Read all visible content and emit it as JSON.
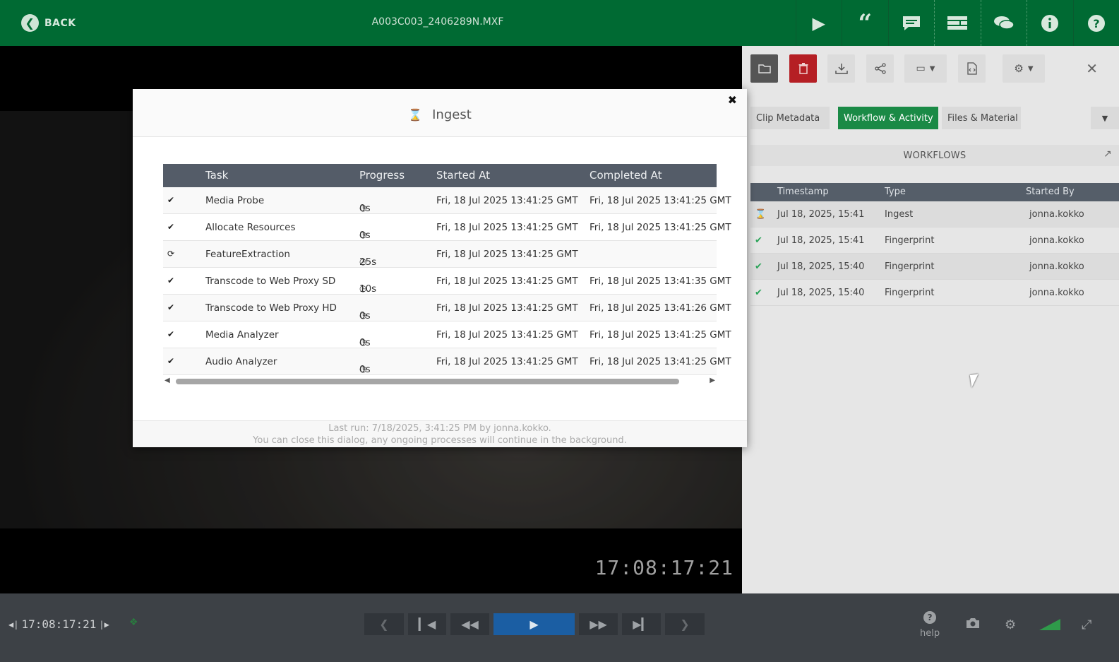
{
  "header": {
    "back_label": "BACK",
    "file_title": "A003C003_2406289N.MXF",
    "icons": [
      "play-icon",
      "quote-icon",
      "comment-icon",
      "layers-icon",
      "chat-icon",
      "info-icon",
      "help-icon"
    ]
  },
  "video": {
    "timecode": "17:08:17:21"
  },
  "panel": {
    "toolbar_icons": [
      "folder-icon",
      "trash-icon",
      "download-icon",
      "share-icon",
      "tag-icon",
      "document-icon",
      "settings-icon",
      "close-icon"
    ],
    "tabs": [
      {
        "label": "Clip Metadata"
      },
      {
        "label": "Workflow & Activity"
      },
      {
        "label": "Files & Material"
      }
    ],
    "workflows_label": "WORKFLOWS",
    "columns": {
      "timestamp": "Timestamp",
      "type": "Type",
      "started_by": "Started By"
    },
    "rows": [
      {
        "status": "running",
        "timestamp": "Jul 18, 2025, 15:41",
        "type": "Ingest",
        "started_by": "jonna.kokko"
      },
      {
        "status": "done",
        "timestamp": "Jul 18, 2025, 15:41",
        "type": "Fingerprint",
        "started_by": "jonna.kokko"
      },
      {
        "status": "done",
        "timestamp": "Jul 18, 2025, 15:40",
        "type": "Fingerprint",
        "started_by": "jonna.kokko"
      },
      {
        "status": "done",
        "timestamp": "Jul 18, 2025, 15:40",
        "type": "Fingerprint",
        "started_by": "jonna.kokko"
      }
    ]
  },
  "modal": {
    "title": "Ingest",
    "columns": {
      "task": "Task",
      "progress": "Progress",
      "started_at": "Started At",
      "completed_at": "Completed At"
    },
    "tasks": [
      {
        "status": "done",
        "task": "Media Probe",
        "progress": "0s",
        "started_at": "Fri, 18 Jul 2025 13:41:25 GMT",
        "completed_at": "Fri, 18 Jul 2025 13:41:25 GMT"
      },
      {
        "status": "done",
        "task": "Allocate Resources",
        "progress": "0s",
        "started_at": "Fri, 18 Jul 2025 13:41:25 GMT",
        "completed_at": "Fri, 18 Jul 2025 13:41:25 GMT"
      },
      {
        "status": "running",
        "task": "FeatureExtraction",
        "progress": "25s",
        "started_at": "Fri, 18 Jul 2025 13:41:25 GMT",
        "completed_at": ""
      },
      {
        "status": "done",
        "task": "Transcode to Web Proxy SD",
        "progress": "10s",
        "started_at": "Fri, 18 Jul 2025 13:41:25 GMT",
        "completed_at": "Fri, 18 Jul 2025 13:41:35 GMT"
      },
      {
        "status": "done",
        "task": "Transcode to Web Proxy HD",
        "progress": "0s",
        "started_at": "Fri, 18 Jul 2025 13:41:25 GMT",
        "completed_at": "Fri, 18 Jul 2025 13:41:26 GMT"
      },
      {
        "status": "done",
        "task": "Media Analyzer",
        "progress": "0s",
        "started_at": "Fri, 18 Jul 2025 13:41:25 GMT",
        "completed_at": "Fri, 18 Jul 2025 13:41:25 GMT"
      },
      {
        "status": "done",
        "task": "Audio Analyzer",
        "progress": "0s",
        "started_at": "Fri, 18 Jul 2025 13:41:25 GMT",
        "completed_at": "Fri, 18 Jul 2025 13:41:25 GMT"
      }
    ],
    "footer_line1": "Last run: 7/18/2025, 3:41:25 PM by jonna.kokko.",
    "footer_line2": "You can close this dialog, any ongoing processes will continue in the background."
  },
  "controls": {
    "timecode": "17:08:17:21",
    "help_label": "help"
  },
  "colors": {
    "brand_green": "#006a33",
    "active_tab": "#1a8a46",
    "delete_red": "#b51f24",
    "play_blue": "#1b5ea3"
  }
}
